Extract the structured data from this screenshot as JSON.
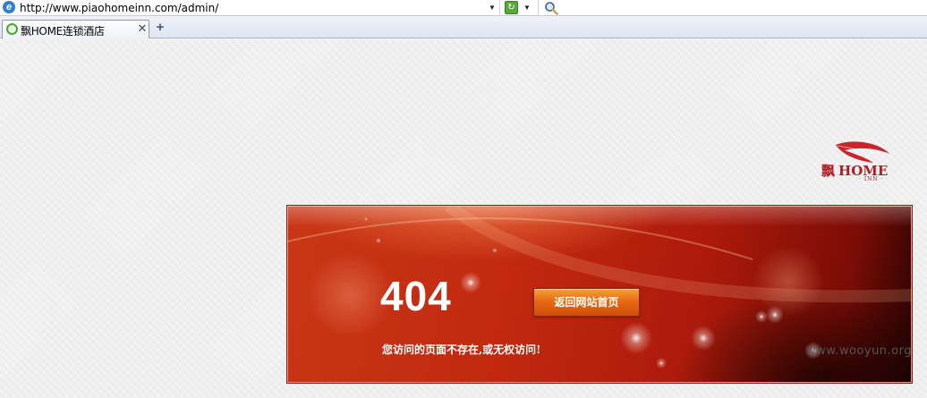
{
  "browser": {
    "url": "http://www.piaohomeinn.com/admin/",
    "tab_title": "飘HOME连锁酒店",
    "tab_close_glyph": "✕",
    "new_tab_glyph": "+",
    "ie_icon": "ie-logo-icon",
    "go_icon": "refresh-go-icon",
    "search_icon": "magnifier-icon"
  },
  "logo": {
    "char": "飘",
    "name": "HOME",
    "sub": "· INN ·",
    "color": "#b01d24"
  },
  "error": {
    "code": "404",
    "button_label": "返回网站首页",
    "message": "您访问的页面不存在,或无权访问!",
    "panel_color": "#c2290f"
  },
  "watermark": "www.wooyun.org"
}
